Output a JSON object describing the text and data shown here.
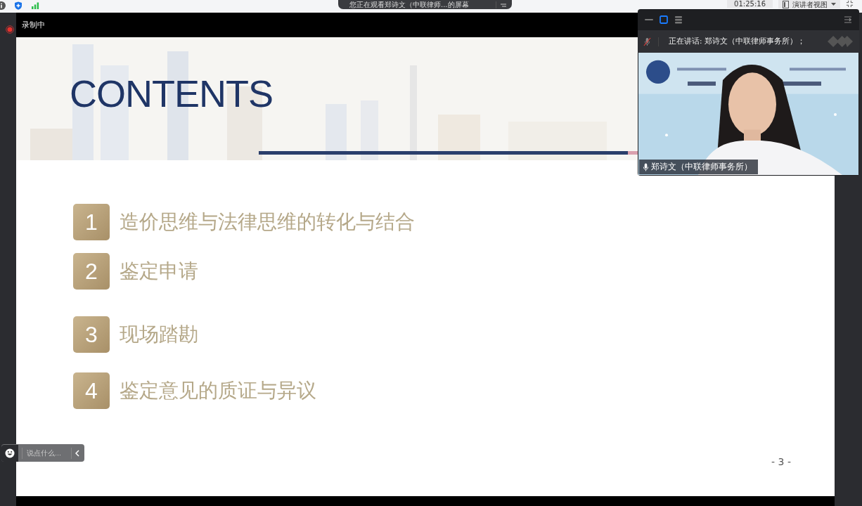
{
  "top_bar": {
    "share_banner": "您正在观看郑诗文（中联律师...的屏幕",
    "timer": "01:25:16",
    "view_menu": "演讲者视图"
  },
  "recording": {
    "label": "录制中"
  },
  "slide": {
    "title": "CONTENTS",
    "items": [
      {
        "number": "1",
        "text": "造价思维与法律思维的转化与结合"
      },
      {
        "number": "2",
        "text": "鉴定申请"
      },
      {
        "number": "3",
        "text": "现场踏勘"
      },
      {
        "number": "4",
        "text": "鉴定意见的质证与异议"
      }
    ],
    "page_number": "- 3 -"
  },
  "video_panel": {
    "view_modes": [
      {
        "kind": "minimize",
        "selected": false
      },
      {
        "kind": "single",
        "selected": true
      },
      {
        "kind": "list",
        "selected": false
      }
    ],
    "mic_muted": true,
    "speaking_label": "正在讲话: 郑诗文（中联律师事务所）；",
    "participant_name": "郑诗文（中联律师事务所）"
  },
  "chat": {
    "placeholder": "说点什么..."
  }
}
